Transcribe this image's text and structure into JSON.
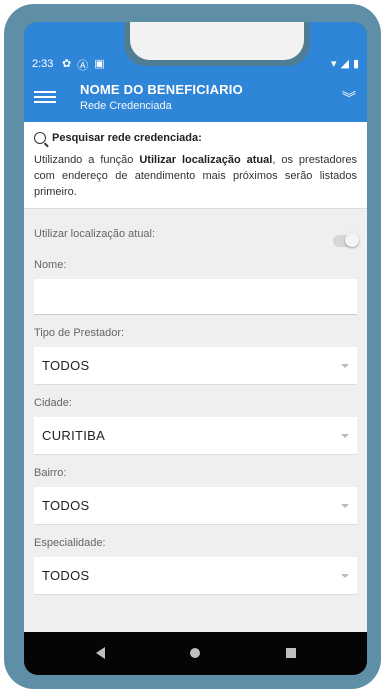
{
  "statusbar": {
    "time": "2:33",
    "left_icons": [
      "gear-icon",
      "a-icon",
      "square-icon"
    ],
    "right_icons": [
      "wifi-icon",
      "signal-icon",
      "battery-icon"
    ]
  },
  "appbar": {
    "title": "NOME DO BENEFICIARIO",
    "subtitle": "Rede Credenciada",
    "color": "#2f86d8"
  },
  "search": {
    "header": "Pesquisar rede credenciada:",
    "desc_before": "Utilizando a função ",
    "desc_bold": "Utilizar localização atual",
    "desc_after": ", os prestadores com endereço de atendimento mais próximos serão listados primeiro."
  },
  "form": {
    "location_label": "Utilizar localização atual:",
    "nome_label": "Nome:",
    "nome_value": "",
    "tipo_label": "Tipo de Prestador:",
    "tipo_value": "TODOS",
    "cidade_label": "Cidade:",
    "cidade_value": "CURITIBA",
    "bairro_label": "Bairro:",
    "bairro_value": "TODOS",
    "especialidade_label": "Especialidade:",
    "especialidade_value": "TODOS"
  },
  "navbar": {
    "icons": [
      "back-icon",
      "home-icon",
      "recents-icon"
    ]
  }
}
